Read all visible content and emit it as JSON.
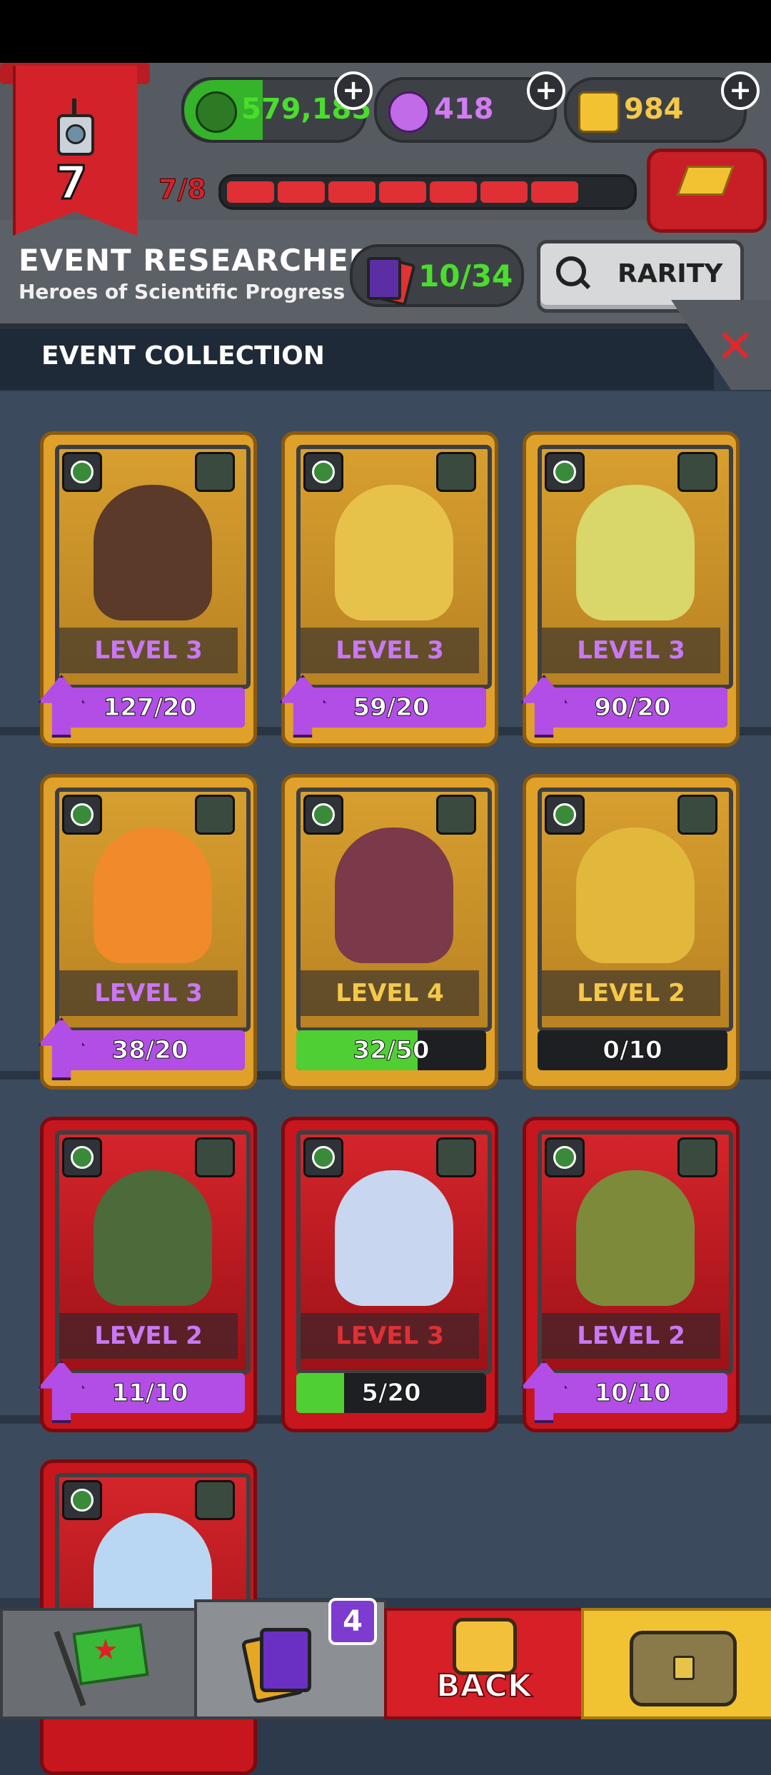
{
  "level_banner": {
    "level": "7"
  },
  "currencies": [
    {
      "name": "dragon-currency",
      "value": "579,185",
      "color": "#4ade2c"
    },
    {
      "name": "potion-currency",
      "value": "418",
      "color": "#d27bf3"
    },
    {
      "name": "gold-currency",
      "value": "984",
      "color": "#f5c84a"
    }
  ],
  "xp": {
    "label": "7/8",
    "filled_segments": 7,
    "total_segments": 8
  },
  "event": {
    "title": "EVENT RESEARCHERS",
    "subtitle": "Heroes of Scientific Progress",
    "cards_count": "10/34",
    "rarity_button": "RARITY"
  },
  "collection_label": "EVENT COLLECTION",
  "cards": [
    {
      "rarity": "gold",
      "level": "LEVEL 3",
      "progress": "127/20",
      "upgradable": true,
      "fill": 1.0,
      "portrait_color": "#5b3a2a"
    },
    {
      "rarity": "gold",
      "level": "LEVEL 3",
      "progress": "59/20",
      "upgradable": true,
      "fill": 1.0,
      "portrait_color": "#e7c24b"
    },
    {
      "rarity": "gold",
      "level": "LEVEL 3",
      "progress": "90/20",
      "upgradable": true,
      "fill": 1.0,
      "portrait_color": "#d9d66a"
    },
    {
      "rarity": "gold",
      "level": "LEVEL 3",
      "progress": "38/20",
      "upgradable": true,
      "fill": 1.0,
      "portrait_color": "#f08a2a"
    },
    {
      "rarity": "gold",
      "level": "LEVEL 4",
      "progress": "32/50",
      "upgradable": false,
      "fill": 0.64,
      "portrait_color": "#7a3a4a"
    },
    {
      "rarity": "gold",
      "level": "LEVEL 2",
      "progress": "0/10",
      "upgradable": false,
      "fill": 0.0,
      "portrait_color": "#e2b83c"
    },
    {
      "rarity": "red",
      "level": "LEVEL 2",
      "progress": "11/10",
      "upgradable": true,
      "fill": 1.0,
      "portrait_color": "#4c6a3a"
    },
    {
      "rarity": "red",
      "level": "LEVEL 3",
      "progress": "5/20",
      "upgradable": false,
      "fill": 0.25,
      "portrait_color": "#c8d6f0"
    },
    {
      "rarity": "red",
      "level": "LEVEL 2",
      "progress": "10/10",
      "upgradable": true,
      "fill": 1.0,
      "portrait_color": "#7d8a3a"
    },
    {
      "rarity": "red",
      "level": "",
      "progress": "",
      "upgradable": false,
      "fill": 0.0,
      "portrait_color": "#b9d7f2"
    }
  ],
  "nav": {
    "cards_badge": "4",
    "back_label": "BACK"
  }
}
